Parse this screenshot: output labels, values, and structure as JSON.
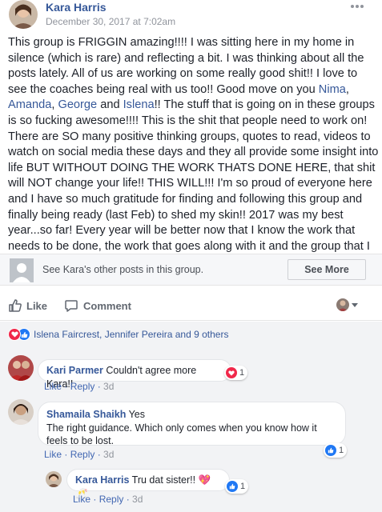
{
  "post": {
    "author": "Kara Harris",
    "date": "December 30, 2017 at 7:02am",
    "more_icon": "more-dots-icon",
    "body": {
      "p1": "This group is FRIGGIN amazing!!!! I was sitting here in my home in silence (which is rare) and reflecting a bit. I was thinking about all the posts lately. All of us are working on some really good shit!! I love to see the coaches being real with us too!! Good move on you ",
      "mention1": "Nima",
      "sep1": ", ",
      "mention2": "Amanda",
      "sep2": ", ",
      "mention3": "George",
      "sep3": " and ",
      "mention4": "Islena",
      "p2": "!! The stuff that is going on in these groups is so fucking awesome!!!! This is the shit that people need to work on! There are SO many positive thinking groups, quotes to read, videos to watch on social media these days and they all provide some insight into life BUT WITHOUT DOING THE WORK THATS DONE HERE, that shit will NOT change your life!! THIS WILL!!! I'm so proud of everyone here and I have so much gratitude for finding and following this group and finally being ready (last Feb) to shed my skin!! 2017 was my best year...so far! Every year will be better now that I know the work that needs to be done, the work that goes along with it and the group that I now call a family!!"
    }
  },
  "other_posts": {
    "text": "See Kara's other posts in this group.",
    "button": "See More"
  },
  "actions": {
    "like": "Like",
    "comment": "Comment"
  },
  "reactions": {
    "summary": "Islena Faircrest, Jennifer Pereira and 9 others"
  },
  "comments": [
    {
      "author": "Kari Parmer",
      "text": "Couldn't agree more Kara!!",
      "like": "Like",
      "reply": "Reply",
      "time": "3d",
      "reaction_count": "1",
      "reaction_type": "heart"
    },
    {
      "author": "Shamaila Shaikh",
      "text_line1": "Yes",
      "text_line2": "The right guidance. Which only comes when you know how it",
      "text_line3": "feels to be lost.",
      "like": "Like",
      "reply": "Reply",
      "time": "3d",
      "reaction_count": "1",
      "reaction_type": "like"
    },
    {
      "author": "Kara Harris",
      "text": "Tru dat sister!!",
      "emoji": "💖🥂",
      "like": "Like",
      "reply": "Reply",
      "time": "3d",
      "reaction_count": "1",
      "reaction_type": "like"
    }
  ],
  "colors": {
    "link": "#365899",
    "meta_link": "#4267b2",
    "muted": "#90949c",
    "heart": "#f0284a",
    "like_blue": "#2078f4"
  }
}
